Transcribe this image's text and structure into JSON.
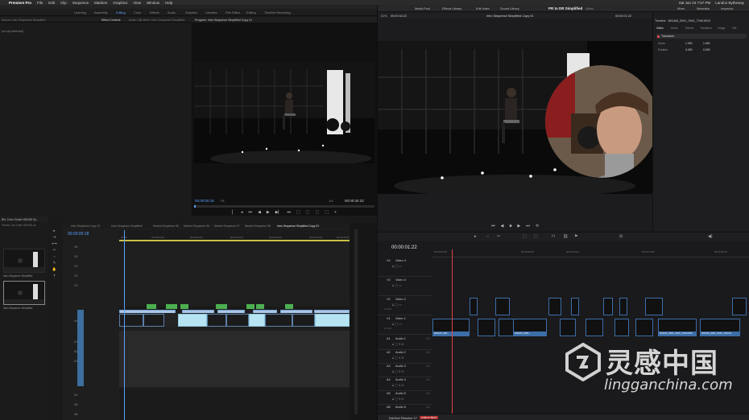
{
  "menubar": {
    "app": "Premiere Pro",
    "items": [
      "File",
      "Edit",
      "Clip",
      "Sequence",
      "Markers",
      "Graphics",
      "View",
      "Window",
      "Help"
    ],
    "clock": "Sat Jan 23  7:57 PM",
    "user": "Landon Bytheway"
  },
  "premiere": {
    "workspaces": [
      "Learning",
      "Assembly",
      "Editing",
      "Color",
      "Effects",
      "Audio",
      "Graphics",
      "Libraries",
      "Film Effect",
      "Editing",
      "Timeline Recording"
    ],
    "active_workspace": "Editing",
    "panel_tabs": [
      "Source: Intro Sequence Simplified",
      "Effect Controls",
      "Audio Clip Mixer: Intro Sequence Simplified"
    ],
    "source_empty": "(no clip selected)",
    "program_title": "Program: Intro Sequence Simplified Copy 01",
    "program_timecode": "00:00:00:18",
    "program_fit": "Fit",
    "program_res": "1/4",
    "program_duration": "00:00:34:22",
    "transport": [
      "▏",
      "◂",
      "⏮",
      "◀",
      "▶",
      "▶▏",
      "⏭",
      "⬚",
      "⬚",
      "⬚",
      "⬚",
      "+"
    ],
    "project_title": "Bin: Color Grade NINJA5 Sy...",
    "project_subtitle": "Fitness Jun Grade NINJA5 cm",
    "project_thumbs": [
      {
        "label": "Intro Sequence Simplified",
        "dur": "34:22"
      },
      {
        "label": "Intro Sequence Simplified",
        "dur": "34:22"
      }
    ],
    "tools": [
      "▸",
      "⇥",
      "⟷",
      "✂",
      "⇔",
      "✎",
      "✋",
      "T"
    ],
    "timeline_tabs": [
      {
        "label": "Intro Sequence Copy 01",
        "active": false
      },
      {
        "label": "Intro Sequence Simplified",
        "active": false
      },
      {
        "label": "Nested Sequence 05",
        "active": false
      },
      {
        "label": "Nested Sequence 06",
        "active": false
      },
      {
        "label": "Nested Sequence 07",
        "active": false
      },
      {
        "label": "Nested Sequence 08",
        "active": false
      },
      {
        "label": "Intro Sequence Simplified Copy 01",
        "active": true
      }
    ],
    "timeline_timecode": "00:00:00:18",
    "ruler_labels": [
      "00:00",
      "00:00:04:23",
      "00:00:09:23",
      "00:00:14:23",
      "00:00:19:23",
      "00:00:24:23",
      "00:00:29:23"
    ],
    "track_labels": [
      "V6",
      "V5",
      "V4",
      "V3",
      "V2",
      "Video 1",
      "A1",
      "A2",
      "A3",
      "A4",
      "A5",
      "A6",
      "A7"
    ]
  },
  "resolve": {
    "top_items": [
      "Media Pool",
      "Effects Library",
      "Edit Index",
      "Sound Library"
    ],
    "project_name": "PR to DR Simplified",
    "edited": "Edited",
    "zoom": "61%",
    "viewer_timecode": "00:00:34:22",
    "viewer_name": "Intro Sequence Simplified Copy 01",
    "viewer_timecode2": "00:00:01:22",
    "transport": [
      "⏮",
      "◀",
      "■",
      "▶",
      "⏭",
      "⟲"
    ],
    "inspector_tabs": [
      "Mixer",
      "Metadata",
      "Inspector"
    ],
    "inspector_clip": "Timeline - NINJA5_S001_S001_T006.MOV",
    "inspector_subtabs": [
      "Video",
      "Audio",
      "Effects",
      "Transition",
      "Image",
      "File"
    ],
    "transform_label": "Transform",
    "inspector_rows": [
      {
        "label": "Zoom",
        "x": "1.000",
        "y": "1.000"
      },
      {
        "label": "Position",
        "x": "0.000",
        "y": "0.000"
      }
    ],
    "timeline_timecode": "00:00:01:22",
    "ruler_labels": [
      "00:00:00:00",
      "00:00:08:00",
      "00:00:16:00",
      "00:00:24:00",
      "00:00:32:00"
    ],
    "video_tracks": [
      {
        "id": "V4",
        "name": "Video 4",
        "count": ""
      },
      {
        "id": "V3",
        "name": "Video 3",
        "count": ""
      },
      {
        "id": "V2",
        "name": "Video 2",
        "count": "0 Clips"
      },
      {
        "id": "V1",
        "name": "Video 1",
        "count": "9 Clips"
      }
    ],
    "audio_tracks": [
      {
        "id": "A1",
        "name": "Audio 1",
        "ch": "1.0"
      },
      {
        "id": "A2",
        "name": "Audio 2",
        "ch": "1.0"
      },
      {
        "id": "A3",
        "name": "Audio 3",
        "ch": "1.0"
      },
      {
        "id": "A4",
        "name": "Audio 4",
        "ch": "1.0"
      },
      {
        "id": "A5",
        "name": "Audio 5",
        "ch": "1.0"
      },
      {
        "id": "A6",
        "name": "Audio 6",
        "ch": "1.0"
      }
    ],
    "clip_labels": [
      "NINJA5_S00...",
      "NINJA5_S001...",
      "NINJA5_S001_S001_T013.MOV",
      "NINJA5_S001_S001_T013 M"
    ],
    "brand": "DaVinci Resolve 17",
    "beta": "PUBLIC BETA"
  },
  "watermark": {
    "text": "灵感中国",
    "url": "lingganchina.com"
  },
  "colors": {
    "premiere_blue": "#5aa0ff",
    "clip_green": "#4caf50",
    "clip_cyan": "#b6e4f2",
    "resolve_red": "#e04444",
    "resolve_clip": "#3c6ea8"
  }
}
